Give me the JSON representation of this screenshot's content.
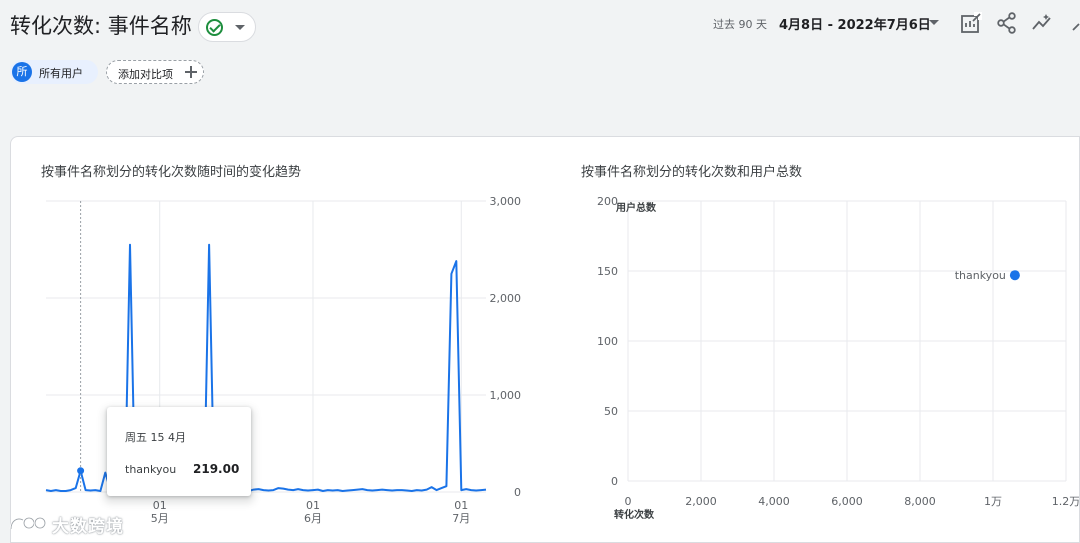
{
  "header": {
    "title": "转化次数: 事件名称",
    "date_prefix": "过去 90 天",
    "date_range": "4月8日 - 2022年7月6日"
  },
  "icons": {
    "status": "check-circle-icon",
    "customize": "edit-chart-icon",
    "share": "share-icon",
    "insights": "insights-icon",
    "overflow": "partial-icon"
  },
  "segment": {
    "avatar": "所",
    "label": "所有用户"
  },
  "compare": {
    "label": "添加对比项"
  },
  "line_card": {
    "title": "按事件名称划分的转化次数随时间的变化趋势"
  },
  "scatter_card": {
    "title": "按事件名称划分的转化次数和用户总数"
  },
  "tooltip": {
    "date": "周五 15 4月",
    "series": "thankyou",
    "value": "219.00"
  },
  "watermark": {
    "text": "大数跨境"
  },
  "colors": {
    "series": "#1a73e8",
    "grid": "#e8eaed",
    "check": "#1e8e3e",
    "accent": "#1a73e8"
  },
  "chart_data": [
    {
      "type": "line",
      "title": "按事件名称划分的转化次数随时间的变化趋势",
      "y_axis_position": "right",
      "ylim": [
        0,
        3000
      ],
      "y_ticks": [
        {
          "value": 0,
          "label": "0"
        },
        {
          "value": 1000,
          "label": "1,000"
        },
        {
          "value": 2000,
          "label": "2,000"
        },
        {
          "value": 3000,
          "label": "3,000"
        }
      ],
      "x_domain": [
        "2022-04-08",
        "2022-07-06"
      ],
      "x_ticks": [
        {
          "date": "2022-05-01",
          "day": "01",
          "month": "5月"
        },
        {
          "date": "2022-06-01",
          "day": "01",
          "month": "6月"
        },
        {
          "date": "2022-07-01",
          "day": "01",
          "month": "7月"
        }
      ],
      "highlight": {
        "date": "2022-04-15",
        "value": 219
      },
      "series": [
        {
          "name": "thankyou",
          "x": [
            "2022-04-08",
            "2022-04-09",
            "2022-04-10",
            "2022-04-11",
            "2022-04-12",
            "2022-04-13",
            "2022-04-14",
            "2022-04-15",
            "2022-04-16",
            "2022-04-17",
            "2022-04-18",
            "2022-04-19",
            "2022-04-20",
            "2022-04-21",
            "2022-04-22",
            "2022-04-23",
            "2022-04-24",
            "2022-04-25",
            "2022-04-26",
            "2022-04-27",
            "2022-04-28",
            "2022-04-29",
            "2022-04-30",
            "2022-05-01",
            "2022-05-02",
            "2022-05-03",
            "2022-05-04",
            "2022-05-05",
            "2022-05-06",
            "2022-05-07",
            "2022-05-08",
            "2022-05-09",
            "2022-05-10",
            "2022-05-11",
            "2022-05-12",
            "2022-05-13",
            "2022-05-14",
            "2022-05-15",
            "2022-05-16",
            "2022-05-17",
            "2022-05-18",
            "2022-05-19",
            "2022-05-20",
            "2022-05-21",
            "2022-05-22",
            "2022-05-23",
            "2022-05-24",
            "2022-05-25",
            "2022-05-26",
            "2022-05-27",
            "2022-05-28",
            "2022-05-29",
            "2022-05-30",
            "2022-05-31",
            "2022-06-01",
            "2022-06-02",
            "2022-06-03",
            "2022-06-04",
            "2022-06-05",
            "2022-06-06",
            "2022-06-07",
            "2022-06-08",
            "2022-06-09",
            "2022-06-10",
            "2022-06-11",
            "2022-06-12",
            "2022-06-13",
            "2022-06-14",
            "2022-06-15",
            "2022-06-16",
            "2022-06-17",
            "2022-06-18",
            "2022-06-19",
            "2022-06-20",
            "2022-06-21",
            "2022-06-22",
            "2022-06-23",
            "2022-06-24",
            "2022-06-25",
            "2022-06-26",
            "2022-06-27",
            "2022-06-28",
            "2022-06-29",
            "2022-06-30",
            "2022-07-01",
            "2022-07-02",
            "2022-07-03",
            "2022-07-04",
            "2022-07-05",
            "2022-07-06"
          ],
          "values": [
            20,
            10,
            20,
            10,
            10,
            20,
            40,
            219,
            20,
            15,
            20,
            10,
            200,
            20,
            10,
            20,
            50,
            2550,
            30,
            20,
            15,
            20,
            30,
            10,
            20,
            15,
            20,
            30,
            20,
            10,
            20,
            15,
            20,
            2550,
            30,
            20,
            15,
            10,
            20,
            15,
            20,
            10,
            25,
            30,
            20,
            15,
            20,
            40,
            35,
            25,
            20,
            30,
            20,
            15,
            20,
            25,
            10,
            20,
            15,
            20,
            10,
            15,
            20,
            25,
            30,
            20,
            15,
            20,
            25,
            20,
            15,
            20,
            20,
            15,
            10,
            20,
            15,
            25,
            50,
            20,
            40,
            60,
            2250,
            2380,
            20,
            30,
            20,
            15,
            20,
            25
          ]
        }
      ]
    },
    {
      "type": "scatter",
      "title": "按事件名称划分的转化次数和用户总数",
      "xlabel": "转化次数",
      "ylabel": "用户总数",
      "xlim": [
        0,
        12000
      ],
      "ylim": [
        0,
        200
      ],
      "x_ticks": [
        {
          "value": 0,
          "label": "0"
        },
        {
          "value": 2000,
          "label": "2,000"
        },
        {
          "value": 4000,
          "label": "4,000"
        },
        {
          "value": 6000,
          "label": "6,000"
        },
        {
          "value": 8000,
          "label": "8,000"
        },
        {
          "value": 10000,
          "label": "1万"
        },
        {
          "value": 12000,
          "label": "1.2万"
        }
      ],
      "y_ticks": [
        {
          "value": 0,
          "label": "0"
        },
        {
          "value": 50,
          "label": "50"
        },
        {
          "value": 100,
          "label": "100"
        },
        {
          "value": 150,
          "label": "150"
        },
        {
          "value": 200,
          "label": "200"
        }
      ],
      "points": [
        {
          "label": "thankyou",
          "x": 10600,
          "y": 147
        }
      ]
    }
  ]
}
